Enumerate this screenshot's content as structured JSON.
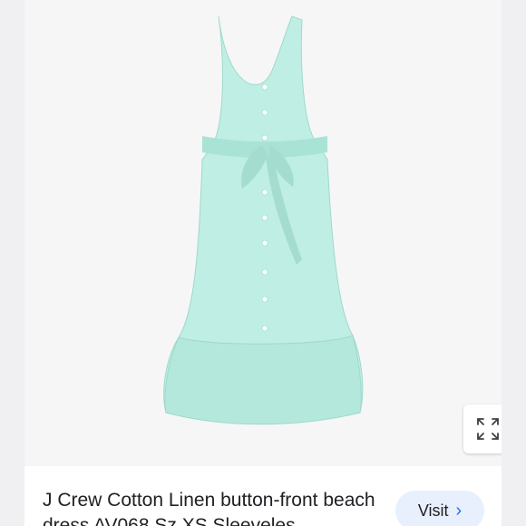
{
  "product": {
    "title": "J Crew Cotton Linen button-front beach dress AV068 Sz XS Sleeveles",
    "dress_color": "#bfeee4"
  },
  "actions": {
    "visit_label": "Visit",
    "visit_icon": "chevron-right-icon",
    "expand_icon": "expand-arrows-icon"
  }
}
